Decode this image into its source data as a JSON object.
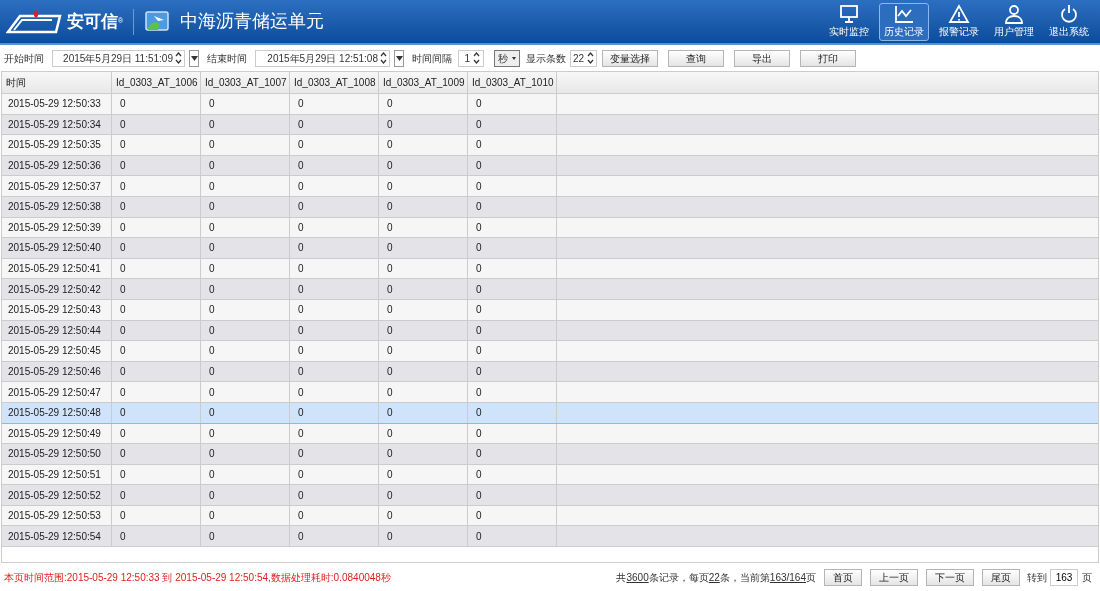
{
  "header": {
    "brand": "安可信",
    "brand_mark": "®",
    "title": "中海沥青储运单元",
    "nav": [
      {
        "label": "实时监控",
        "kind": "monitor",
        "selected": false
      },
      {
        "label": "历史记录",
        "kind": "chart",
        "selected": true
      },
      {
        "label": "报警记录",
        "kind": "alert",
        "selected": false
      },
      {
        "label": "用户管理",
        "kind": "user",
        "selected": false
      },
      {
        "label": "退出系统",
        "kind": "power",
        "selected": false
      }
    ]
  },
  "toolbar": {
    "start_label": "开始时间",
    "start_value": "2015年5月29日 11:51:09",
    "end_label": "结束时间",
    "end_value": "2015年5月29日 12:51:08",
    "interval_label": "时间间隔",
    "interval_value": "1",
    "unit_value": "秒",
    "count_label": "显示条数",
    "count_value": "22",
    "buttons": [
      "变量选择",
      "查询",
      "导出",
      "打印"
    ]
  },
  "table": {
    "columns": [
      "时间",
      "Id_0303_AT_1006",
      "Id_0303_AT_1007",
      "Id_0303_AT_1008",
      "Id_0303_AT_1009",
      "Id_0303_AT_1010"
    ],
    "rows": [
      {
        "cells": [
          "2015-05-29 12:50:33",
          "0",
          "0",
          "0",
          "0",
          "0"
        ],
        "selected": false
      },
      {
        "cells": [
          "2015-05-29 12:50:34",
          "0",
          "0",
          "0",
          "0",
          "0"
        ],
        "selected": false
      },
      {
        "cells": [
          "2015-05-29 12:50:35",
          "0",
          "0",
          "0",
          "0",
          "0"
        ],
        "selected": false
      },
      {
        "cells": [
          "2015-05-29 12:50:36",
          "0",
          "0",
          "0",
          "0",
          "0"
        ],
        "selected": false
      },
      {
        "cells": [
          "2015-05-29 12:50:37",
          "0",
          "0",
          "0",
          "0",
          "0"
        ],
        "selected": false
      },
      {
        "cells": [
          "2015-05-29 12:50:38",
          "0",
          "0",
          "0",
          "0",
          "0"
        ],
        "selected": false
      },
      {
        "cells": [
          "2015-05-29 12:50:39",
          "0",
          "0",
          "0",
          "0",
          "0"
        ],
        "selected": false
      },
      {
        "cells": [
          "2015-05-29 12:50:40",
          "0",
          "0",
          "0",
          "0",
          "0"
        ],
        "selected": false
      },
      {
        "cells": [
          "2015-05-29 12:50:41",
          "0",
          "0",
          "0",
          "0",
          "0"
        ],
        "selected": false
      },
      {
        "cells": [
          "2015-05-29 12:50:42",
          "0",
          "0",
          "0",
          "0",
          "0"
        ],
        "selected": false
      },
      {
        "cells": [
          "2015-05-29 12:50:43",
          "0",
          "0",
          "0",
          "0",
          "0"
        ],
        "selected": false
      },
      {
        "cells": [
          "2015-05-29 12:50:44",
          "0",
          "0",
          "0",
          "0",
          "0"
        ],
        "selected": false
      },
      {
        "cells": [
          "2015-05-29 12:50:45",
          "0",
          "0",
          "0",
          "0",
          "0"
        ],
        "selected": false
      },
      {
        "cells": [
          "2015-05-29 12:50:46",
          "0",
          "0",
          "0",
          "0",
          "0"
        ],
        "selected": false
      },
      {
        "cells": [
          "2015-05-29 12:50:47",
          "0",
          "0",
          "0",
          "0",
          "0"
        ],
        "selected": false
      },
      {
        "cells": [
          "2015-05-29 12:50:48",
          "0",
          "0",
          "0",
          "0",
          "0"
        ],
        "selected": true
      },
      {
        "cells": [
          "2015-05-29 12:50:49",
          "0",
          "0",
          "0",
          "0",
          "0"
        ],
        "selected": false
      },
      {
        "cells": [
          "2015-05-29 12:50:50",
          "0",
          "0",
          "0",
          "0",
          "0"
        ],
        "selected": false
      },
      {
        "cells": [
          "2015-05-29 12:50:51",
          "0",
          "0",
          "0",
          "0",
          "0"
        ],
        "selected": false
      },
      {
        "cells": [
          "2015-05-29 12:50:52",
          "0",
          "0",
          "0",
          "0",
          "0"
        ],
        "selected": false
      },
      {
        "cells": [
          "2015-05-29 12:50:53",
          "0",
          "0",
          "0",
          "0",
          "0"
        ],
        "selected": false
      },
      {
        "cells": [
          "2015-05-29 12:50:54",
          "0",
          "0",
          "0",
          "0",
          "0"
        ],
        "selected": false
      }
    ]
  },
  "footer": {
    "status": "本页时间范围:2015-05-29 12:50:33 到 2015-05-29 12:50:54,数据处理耗时:0.0840048秒",
    "summary": [
      {
        "text": "共",
        "underline": false
      },
      {
        "text": "3600",
        "underline": true
      },
      {
        "text": "条记录，每页",
        "underline": false
      },
      {
        "text": "22",
        "underline": true
      },
      {
        "text": "条，当前第",
        "underline": false
      },
      {
        "text": "163/164",
        "underline": true
      },
      {
        "text": "页",
        "underline": false
      }
    ],
    "pager_buttons": [
      "首页",
      "上一页",
      "下一页",
      "尾页"
    ],
    "goto_label": "转到",
    "goto_value": "163",
    "goto_suffix": "页"
  }
}
